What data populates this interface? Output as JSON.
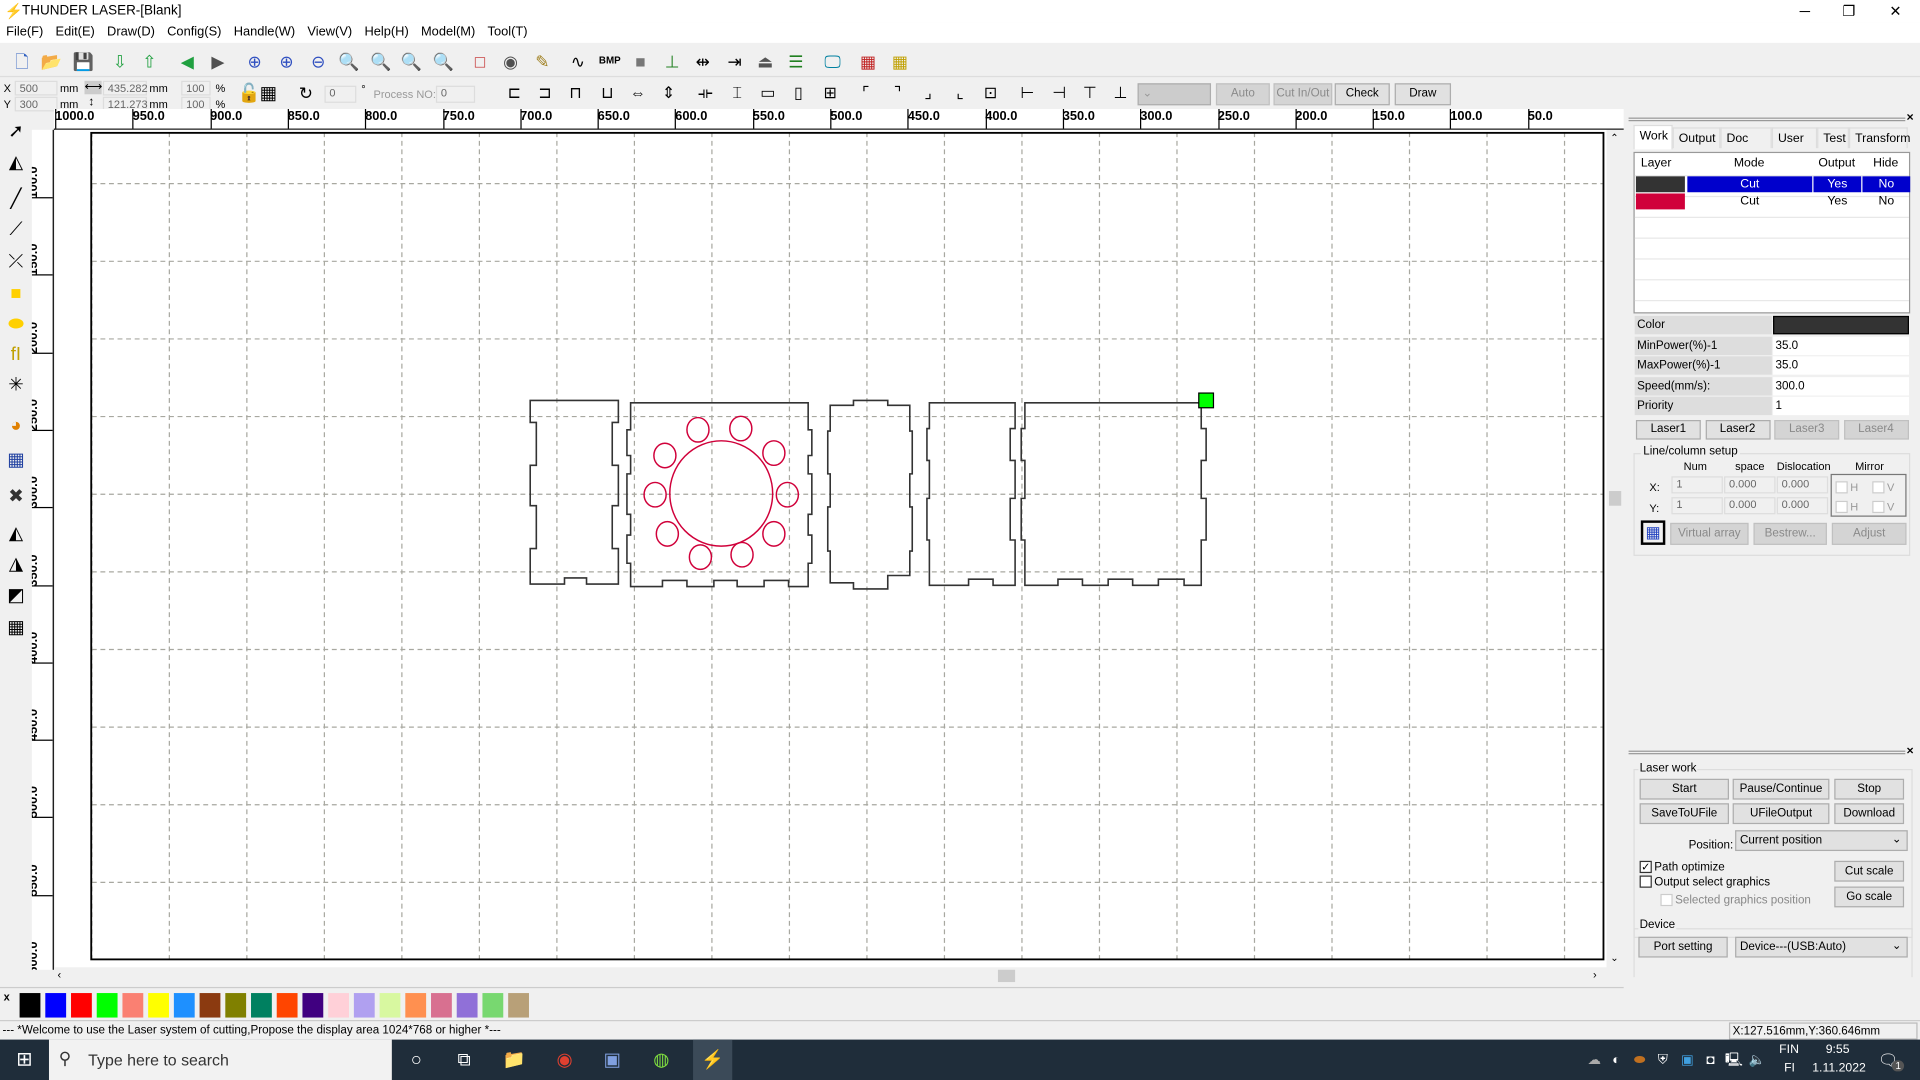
{
  "window": {
    "title": "THUNDER LASER-[Blank]",
    "minimize": "─",
    "restore": "❐",
    "close": "✕"
  },
  "menu": [
    "File(F)",
    "Edit(E)",
    "Draw(D)",
    "Config(S)",
    "Handle(W)",
    "View(V)",
    "Help(H)",
    "Model(M)",
    "Tool(T)"
  ],
  "toolbar1": [
    {
      "name": "new-file-icon",
      "g": "🗋",
      "c": "#3060c0"
    },
    {
      "name": "open-folder-icon",
      "g": "📂",
      "c": "#e0a020"
    },
    {
      "name": "save-icon",
      "g": "💾",
      "c": "#2040a0"
    },
    {
      "name": "import-icon",
      "g": "⇩",
      "c": "#20a040"
    },
    {
      "name": "export-icon",
      "g": "⇧",
      "c": "#20a040"
    },
    {
      "name": "undo-icon",
      "g": "◀",
      "c": "#20a040"
    },
    {
      "name": "redo-icon",
      "g": "▶",
      "c": "#505050"
    },
    {
      "name": "zoom-pan-icon",
      "g": "⊕",
      "c": "#3050c0"
    },
    {
      "name": "zoom-in-icon",
      "g": "⊕",
      "c": "#3050c0"
    },
    {
      "name": "zoom-out-icon",
      "g": "⊖",
      "c": "#3050c0"
    },
    {
      "name": "zoom-page-icon",
      "g": "🔍",
      "c": "#3050c0"
    },
    {
      "name": "zoom-selection-icon",
      "g": "🔍",
      "c": "#606060"
    },
    {
      "name": "zoom-all-icon",
      "g": "🔍",
      "c": "#3050c0"
    },
    {
      "name": "zoom-window-icon",
      "g": "🔍",
      "c": "#3050c0"
    },
    {
      "name": "select-box-icon",
      "g": "□",
      "c": "#c02020"
    },
    {
      "name": "node-icon",
      "g": "◉",
      "c": "#505050"
    },
    {
      "name": "pen-icon",
      "g": "✎",
      "c": "#a08020"
    },
    {
      "name": "curve-icon",
      "g": "∿",
      "c": "#000"
    },
    {
      "name": "bitmap-icon",
      "g": "BMP",
      "c": "#000"
    },
    {
      "name": "fill-icon",
      "g": "■",
      "c": "#777"
    },
    {
      "name": "tree-icon",
      "g": "⊥",
      "c": "#208020"
    },
    {
      "name": "cut-inout-icon",
      "g": "⇹",
      "c": "#000"
    },
    {
      "name": "arrow-right-icon",
      "g": "⇥",
      "c": "#000"
    },
    {
      "name": "head-icon",
      "g": "⏏",
      "c": "#555"
    },
    {
      "name": "list-icon",
      "g": "☰",
      "c": "#208020"
    },
    {
      "name": "monitor-icon",
      "g": "🖵",
      "c": "#0080a0"
    },
    {
      "name": "simulate-icon",
      "g": "▦",
      "c": "#c02020"
    },
    {
      "name": "frame-icon",
      "g": "▦",
      "c": "#c0a000"
    }
  ],
  "coords": {
    "x_label": "X",
    "y_label": "Y",
    "x": "500",
    "y": "300",
    "unit": "mm",
    "w": "435.282",
    "h": "121.273",
    "w_pct": "100",
    "h_pct": "100",
    "pct": "%",
    "rotate": "0",
    "deg": "°",
    "process_label": "Process NO:",
    "process": "0"
  },
  "actions": {
    "auto": "Auto",
    "cut_inout": "Cut In/Out",
    "check": "Check",
    "draw": "Draw"
  },
  "ruler_top": [
    "1000.0",
    "950.0",
    "900.0",
    "850.0",
    "800.0",
    "750.0",
    "700.0",
    "650.0",
    "600.0",
    "550.0",
    "500.0",
    "450.0",
    "400.0",
    "350.0",
    "300.0",
    "250.0",
    "200.0",
    "150.0",
    "100.0",
    "50.0"
  ],
  "ruler_left": [
    "100.0",
    "150.0",
    "200.0",
    "250.0",
    "300.0",
    "350.0",
    "400.0",
    "450.0",
    "500.0",
    "550.0",
    "600.0"
  ],
  "left_tools": [
    {
      "name": "select-arrow-icon",
      "g": "➚"
    },
    {
      "name": "node-edit-icon",
      "g": "◭"
    },
    {
      "name": "line-icon",
      "g": "╱"
    },
    {
      "name": "polyline-icon",
      "g": "⟋"
    },
    {
      "name": "bezier-icon",
      "g": "⤫"
    },
    {
      "name": "rectangle-icon",
      "g": "■",
      "c": "#ffd000"
    },
    {
      "name": "ellipse-icon",
      "g": "⬬",
      "c": "#ffd000"
    },
    {
      "name": "text-icon",
      "g": "fI",
      "c": "#c0a000"
    },
    {
      "name": "point-icon",
      "g": "✳"
    },
    {
      "name": "camera-icon",
      "g": "◕",
      "c": "#e08000"
    },
    {
      "name": "array-icon",
      "g": "▦",
      "c": "#2040a0"
    },
    {
      "name": "delete-icon",
      "g": "✖",
      "c": "#333"
    },
    {
      "name": "mirror-h-icon",
      "g": "◭"
    },
    {
      "name": "mirror-v-icon",
      "g": "◮"
    },
    {
      "name": "origin-icon",
      "g": "◩"
    },
    {
      "name": "grid-array-icon",
      "g": "▦"
    }
  ],
  "palette": [
    "#000000",
    "#0000ff",
    "#ff0000",
    "#00ff00",
    "#fa8072",
    "#ffff00",
    "#1e90ff",
    "#8b3a10",
    "#808000",
    "#008060",
    "#ff4500",
    "#400080",
    "#ffd0d8",
    "#b0a0f0",
    "#d8f8a0",
    "#ff9050",
    "#d87090",
    "#9070d8",
    "#78d870",
    "#b8a078"
  ],
  "palette_close": "x",
  "status": {
    "message": "--- *Welcome to use the Laser system of cutting,Propose the display area 1024*768 or higher *---",
    "position": "X:127.516mm,Y:360.646mm"
  },
  "panel": {
    "close": "×",
    "tabs": [
      "Work",
      "Output",
      "Doc",
      "User",
      "Test",
      "Transform"
    ],
    "columns": [
      "Layer",
      "Mode",
      "Output",
      "Hide"
    ],
    "layers": [
      {
        "color": "#333333",
        "mode": "Cut",
        "output": "Yes",
        "hide": "No",
        "selected": true
      },
      {
        "color": "#d0003a",
        "mode": "Cut",
        "output": "Yes",
        "hide": "No",
        "selected": false
      }
    ],
    "props": [
      {
        "k": "Color",
        "v": ""
      },
      {
        "k": "MinPower(%)-1",
        "v": "35.0"
      },
      {
        "k": "MaxPower(%)-1",
        "v": "35.0"
      },
      {
        "k": "Speed(mm/s):",
        "v": "300.0"
      },
      {
        "k": "Priority",
        "v": "1"
      }
    ],
    "color_value": "#333333",
    "lasers": [
      {
        "label": "Laser1",
        "enabled": true
      },
      {
        "label": "Laser2",
        "enabled": true
      },
      {
        "label": "Laser3",
        "enabled": false
      },
      {
        "label": "Laser4",
        "enabled": false
      }
    ],
    "array": {
      "title": "Line/column setup",
      "num": "Num",
      "space": "space",
      "dislocation": "Dislocation",
      "mirror": "Mirror",
      "x_label": "X:",
      "y_label": "Y:",
      "x_num": "1",
      "x_space": "0.000",
      "x_disl": "0.000",
      "y_num": "1",
      "y_space": "0.000",
      "y_disl": "0.000",
      "h": "H",
      "v": "V",
      "virtual": "Virtual array",
      "bestrew": "Bestrew...",
      "adjust": "Adjust"
    }
  },
  "laserwork": {
    "close": "×",
    "title": "Laser work",
    "start": "Start",
    "pause": "Pause/Continue",
    "stop": "Stop",
    "save_ufile": "SaveToUFile",
    "ufile_output": "UFileOutput",
    "download": "Download",
    "position_label": "Position:",
    "position": "Current position",
    "path_optimize": "Path optimize",
    "path_optimize_checked": true,
    "output_select": "Output select graphics",
    "output_select_checked": false,
    "selected_pos": "Selected graphics position",
    "cut_scale": "Cut scale",
    "go_scale": "Go scale",
    "device_title": "Device",
    "port_setting": "Port setting",
    "device": "Device---(USB:Auto)"
  },
  "taskbar": {
    "search_placeholder": "Type here to search",
    "lang1": "FIN",
    "lang2": "FI",
    "time": "9:55",
    "date": "1.11.2022",
    "notifications": "1"
  }
}
